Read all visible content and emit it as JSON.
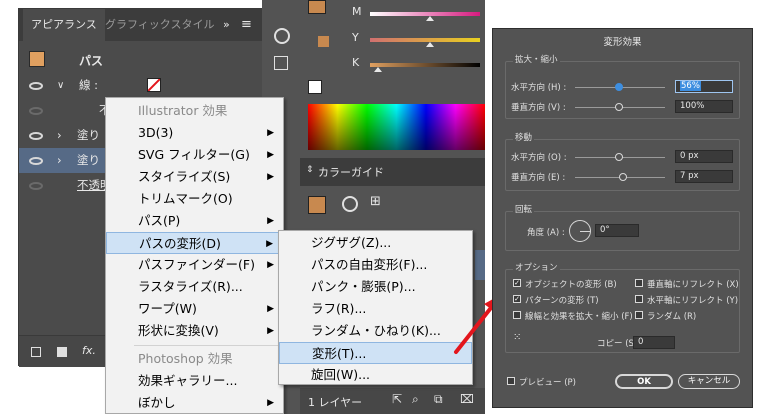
{
  "appearance_panel": {
    "tabs": [
      "アピアランス",
      "グラフィックスタイル"
    ],
    "tab_more": "»",
    "title_row": "パス",
    "rows": [
      {
        "label": "線 :",
        "visible": true
      },
      {
        "label": "不",
        "visible": false
      },
      {
        "label": "塗り",
        "visible": true
      },
      {
        "label": "塗り",
        "visible": true
      },
      {
        "label": "不透明",
        "visible": false
      }
    ],
    "fx_label": "fx."
  },
  "menu": {
    "header": "Illustrator 効果",
    "items": [
      "3D(3)",
      "SVG フィルター(G)",
      "スタイライズ(S)",
      "トリムマーク(O)",
      "パス(P)",
      "パスの変形(D)",
      "パスファインダー(F)",
      "ラスタライズ(R)...",
      "ワープ(W)",
      "形状に変換(V)"
    ],
    "header2": "Photoshop 効果",
    "items2": [
      "効果ギャラリー...",
      "ぼかし"
    ]
  },
  "submenu": {
    "items": [
      "ジグザグ(Z)...",
      "パスの自由変形(F)...",
      "パンク・膨張(P)...",
      "ラフ(R)...",
      "ランダム・ひねり(K)...",
      "変形(T)...",
      "旋回(W)..."
    ]
  },
  "color_panel": {
    "sliders": [
      "M",
      "Y",
      "K"
    ],
    "color_guide_title": "カラーガイド",
    "layers_label": "1 レイヤー"
  },
  "dialog": {
    "title": "変形効果",
    "scale_group": "拡大・縮小",
    "h_scale_label": "水平方向 (H) :",
    "h_scale_value": "56%",
    "v_scale_label": "垂直方向 (V) :",
    "v_scale_value": "100%",
    "move_group": "移動",
    "h_move_label": "水平方向 (O) :",
    "h_move_value": "0 px",
    "v_move_label": "垂直方向 (E) :",
    "v_move_value": "7 px",
    "rotate_group": "回転",
    "angle_label": "角度 (A) :",
    "angle_value": "0°",
    "options_group": "オプション",
    "opt_transform_objects": "オブジェクトの変形 (B)",
    "opt_reflect_v": "垂直軸にリフレクト (X)",
    "opt_transform_patterns": "パターンの変形 (T)",
    "opt_reflect_h": "水平軸にリフレクト (Y)",
    "opt_scale_strokes": "線幅と効果を拡大・縮小 (F)",
    "opt_random": "ランダム (R)",
    "copies_label": "コピー (S)",
    "copies_value": "0",
    "preview_label": "プレビュー (P)",
    "ok_label": "OK",
    "cancel_label": "キャンセル"
  },
  "colors": {
    "panel_dark": "#535353",
    "highlight": "#cfe2f5",
    "accent_blue": "#3d8ee0",
    "arrow_red": "#e3161d",
    "swatch_orange": "#c8894f"
  }
}
